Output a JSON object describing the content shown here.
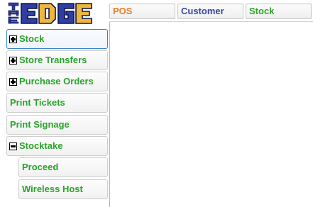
{
  "logo": {
    "text": "THE EDGE"
  },
  "tabs": [
    {
      "label": "POS",
      "color": "#e57f25"
    },
    {
      "label": "Customer",
      "color": "#3b46a6"
    },
    {
      "label": "Stock",
      "color": "#2aa32a"
    }
  ],
  "sidebar": {
    "items": [
      {
        "label": "Stock",
        "icon": "plus-icon",
        "selected": true
      },
      {
        "label": "Store Transfers",
        "icon": "plus-icon"
      },
      {
        "label": "Purchase Orders",
        "icon": "plus-icon"
      },
      {
        "label": "Print Tickets"
      },
      {
        "label": "Print Signage"
      },
      {
        "label": "Stocktake",
        "icon": "minus-icon",
        "expanded": true
      },
      {
        "label": "Proceed",
        "indent": true
      },
      {
        "label": "Wireless Host",
        "indent": true
      }
    ]
  }
}
